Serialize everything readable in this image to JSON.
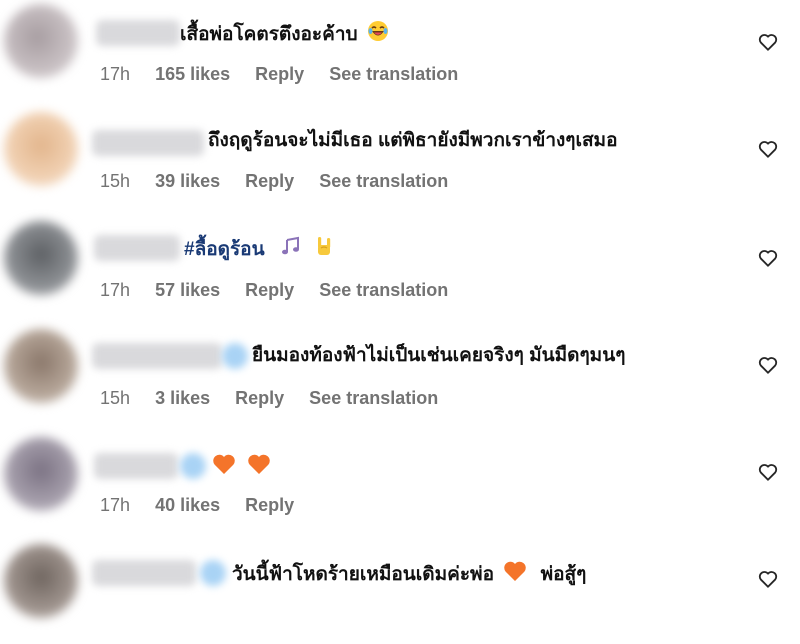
{
  "comments": [
    {
      "text": "เสื้อพ่อโคตรตึงอะค้าบ",
      "emojis": [
        "laughing-face-emoji"
      ],
      "time": "17h",
      "likes": "165 likes",
      "reply": "Reply",
      "translate": "See translation"
    },
    {
      "text": "ถึงฤดูร้อนจะไม่มีเธอ แต่พิธายังมีพวกเราข้างๆเสมอ",
      "emojis": [],
      "time": "15h",
      "likes": "39 likes",
      "reply": "Reply",
      "translate": "See translation"
    },
    {
      "text": "#ลื้อดูร้อน",
      "emojis": [
        "music-notes-emoji",
        "rock-hand-emoji"
      ],
      "time": "17h",
      "likes": "57 likes",
      "reply": "Reply",
      "translate": "See translation"
    },
    {
      "text": "ยืนมองท้องฟ้าไม่เป็นเช่นเคยจริงๆ มันมืดๆมนๆ",
      "emojis": [],
      "time": "15h",
      "likes": "3 likes",
      "reply": "Reply",
      "translate": "See translation"
    },
    {
      "text": "",
      "emojis": [
        "orange-heart-emoji",
        "orange-heart-emoji"
      ],
      "time": "17h",
      "likes": "40 likes",
      "reply": "Reply",
      "translate": ""
    },
    {
      "text": "วันนี้ฟ้าโหดร้ายเหมือนเดิมค่ะพ่อ",
      "text_after": "พ่อสู้ๆ",
      "emojis": [
        "orange-heart-emoji"
      ],
      "time": "",
      "likes": "",
      "reply": "",
      "translate": ""
    }
  ],
  "colors": {
    "meta_text": "#737373",
    "hashtag": "#1a3a75",
    "verified_badge": "#a9d3f5",
    "orange_heart": "#f4742a"
  },
  "icons": {
    "like": "heart-outline-icon"
  }
}
